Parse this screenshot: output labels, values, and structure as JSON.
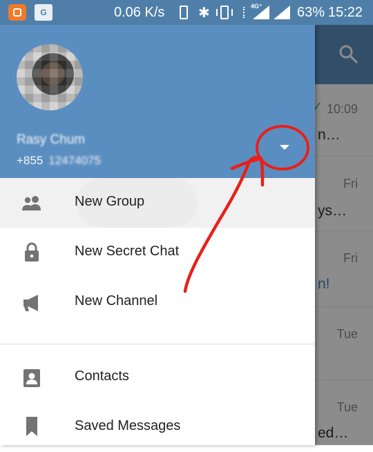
{
  "status_bar": {
    "speed": "0.06 K/s",
    "network_type": "4G⁺",
    "battery": "63%",
    "time": "15:22",
    "app_badge": "G"
  },
  "chat_list": {
    "rows": [
      {
        "time": "10:09",
        "snippet": "n…",
        "checked": true
      },
      {
        "time": "Fri",
        "snippet": "ys…"
      },
      {
        "time": "Fri",
        "snippet": "n!",
        "highlight": true
      },
      {
        "time": "Tue",
        "snippet": ""
      },
      {
        "time": "Tue",
        "snippet": "ed…"
      }
    ]
  },
  "drawer": {
    "user_name": "Rasy Chum",
    "user_phone_prefix": "+855",
    "user_phone_number": "12474075",
    "menu": [
      {
        "label": "New Group",
        "icon": "group-icon"
      },
      {
        "label": "New Secret Chat",
        "icon": "lock-icon"
      },
      {
        "label": "New Channel",
        "icon": "megaphone-icon"
      },
      {
        "label": "Contacts",
        "icon": "contact-icon"
      },
      {
        "label": "Saved Messages",
        "icon": "bookmark-icon"
      }
    ]
  },
  "colors": {
    "header": "#5b8ec0",
    "status_bar": "#4f7fa8",
    "annotation": "#e8201a"
  }
}
